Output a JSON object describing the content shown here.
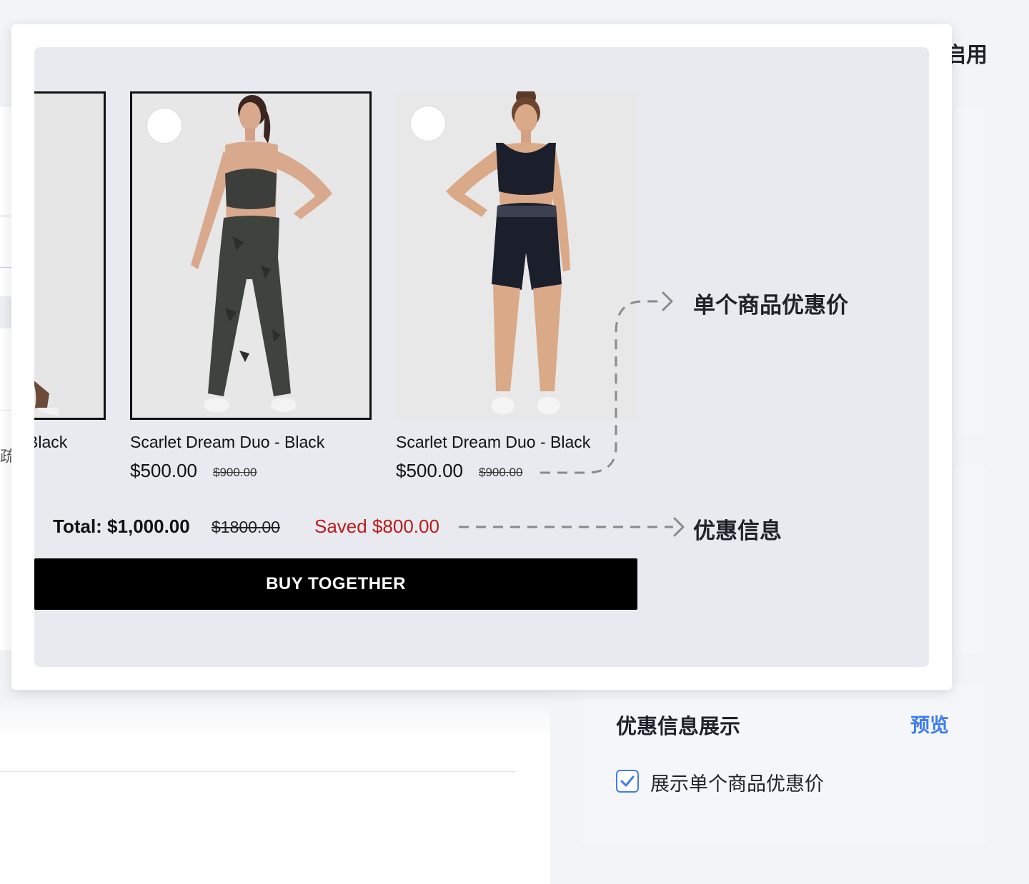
{
  "background": {
    "top_right_text": "启用",
    "left_partial_char": "疏"
  },
  "preview": {
    "products": [
      {
        "name": "Black",
        "selected": true
      },
      {
        "name": "Scarlet Dream Duo - Black",
        "price": "$500.00",
        "old_price": "$900.00",
        "selected": true
      },
      {
        "name": "Scarlet Dream Duo - Black",
        "price": "$500.00",
        "old_price": "$900.00",
        "selected": false
      }
    ],
    "total_label": "Total: $1,000.00",
    "total_old": "$1800.00",
    "saved": "Saved $800.00",
    "buy_button": "BUY TOGETHER"
  },
  "annotations": {
    "single_price": "单个商品优惠价",
    "promo_info": "优惠信息"
  },
  "promo_settings": {
    "title": "优惠信息展示",
    "preview_link": "预览",
    "checkbox_label": "展示单个商品优惠价",
    "checkbox_checked": true,
    "accent_color": "#3e7cf0"
  }
}
